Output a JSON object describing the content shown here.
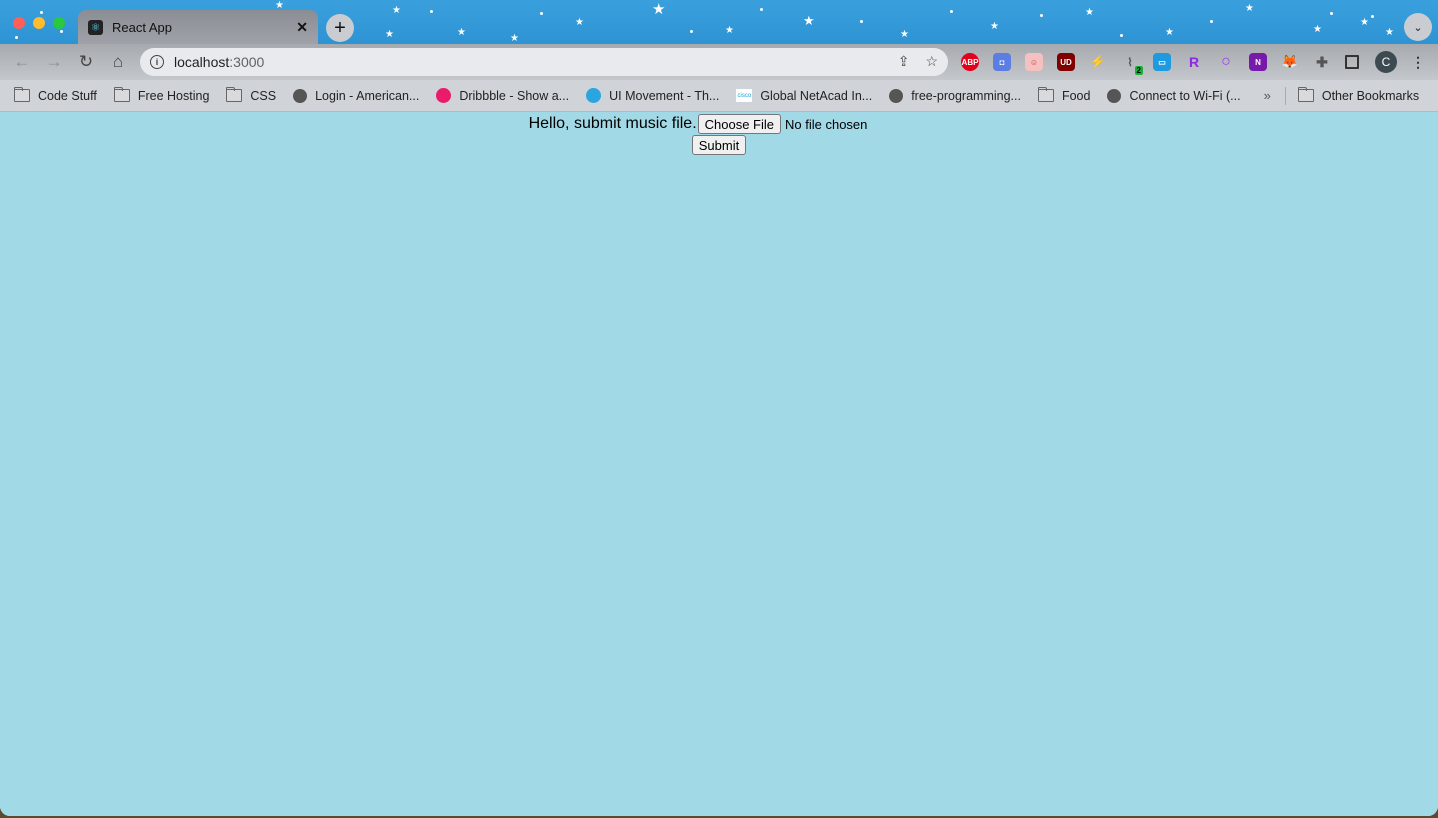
{
  "browser": {
    "tab": {
      "title": "React App",
      "close_icon": "close-icon"
    },
    "new_tab_label": "+",
    "address_bar": {
      "host": "localhost",
      "port": ":3000"
    },
    "extensions": [
      {
        "name": "adblock-plus",
        "label": "ABP",
        "color": "#e3001b"
      },
      {
        "name": "screenshot",
        "label": "◘",
        "color": "#5b7ee5"
      },
      {
        "name": "piggy",
        "label": "☺",
        "color": "#e57a7a"
      },
      {
        "name": "ublock-origin",
        "label": "UD",
        "color": "#800000"
      },
      {
        "name": "lightning",
        "label": "⚡",
        "color": "#d4b400"
      },
      {
        "name": "activity",
        "label": "2",
        "color": "#16b13a"
      },
      {
        "name": "window-resizer",
        "label": "▭",
        "color": "#1e9ae0"
      },
      {
        "name": "r-extension",
        "label": "R",
        "color": "#8a2be2"
      },
      {
        "name": "ring",
        "label": "○",
        "color": "#9b30ff"
      },
      {
        "name": "onenote",
        "label": "N",
        "color": "#7719aa"
      },
      {
        "name": "metamask",
        "label": "🦊",
        "color": "#f6851b"
      }
    ],
    "profile_initial": "C",
    "bookmarks": [
      {
        "label": "Code Stuff",
        "icon": "folder"
      },
      {
        "label": "Free Hosting",
        "icon": "folder"
      },
      {
        "label": "CSS",
        "icon": "folder"
      },
      {
        "label": "Login - American...",
        "icon": "globe"
      },
      {
        "label": "Dribbble - Show a...",
        "icon": "dribbble"
      },
      {
        "label": "UI Movement - Th...",
        "icon": "uimove"
      },
      {
        "label": "Global NetAcad In...",
        "icon": "cisco"
      },
      {
        "label": "free-programming...",
        "icon": "globe"
      },
      {
        "label": "Food",
        "icon": "folder"
      },
      {
        "label": "Connect to Wi-Fi (...",
        "icon": "globe"
      }
    ],
    "more_bookmarks": "»",
    "other_bookmarks": "Other Bookmarks"
  },
  "page": {
    "greeting": "Hello, submit music file.",
    "choose_file_label": "Choose File",
    "file_status": "No file chosen",
    "submit_label": "Submit"
  }
}
